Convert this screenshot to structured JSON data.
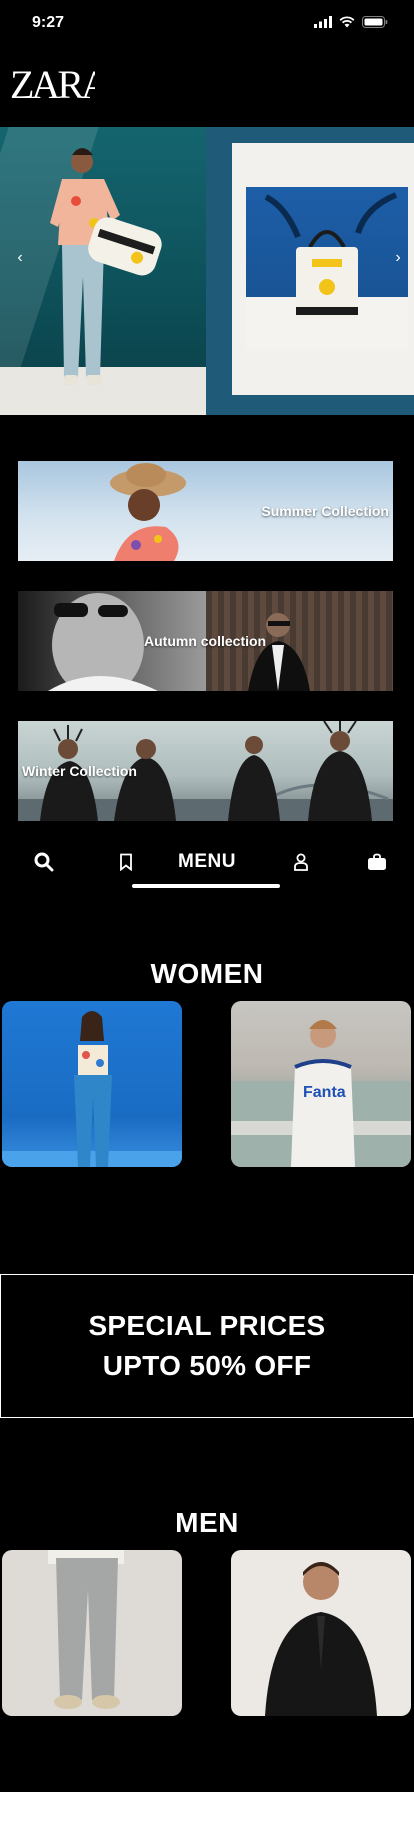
{
  "status_bar": {
    "time": "9:27"
  },
  "brand": {
    "logo_text": "ZARA"
  },
  "hero": {
    "prev_icon": "chevron-left-icon",
    "next_icon": "chevron-right-icon"
  },
  "collections": [
    {
      "label": "Summer Collection"
    },
    {
      "label": "Autumn collection"
    },
    {
      "label": "Winter Collection"
    }
  ],
  "bottom_nav": {
    "search_icon": "search-icon",
    "bookmark_icon": "bookmark-icon",
    "menu_label": "MENU",
    "account_icon": "user-icon",
    "bag_icon": "shopping-bag-icon"
  },
  "sections": {
    "women_title": "WOMEN",
    "men_title": "MEN"
  },
  "promo": {
    "line1": "SPECIAL PRICES",
    "line2": "UPTO 50% OFF"
  },
  "colors": {
    "background": "#000000",
    "text": "#ffffff"
  }
}
